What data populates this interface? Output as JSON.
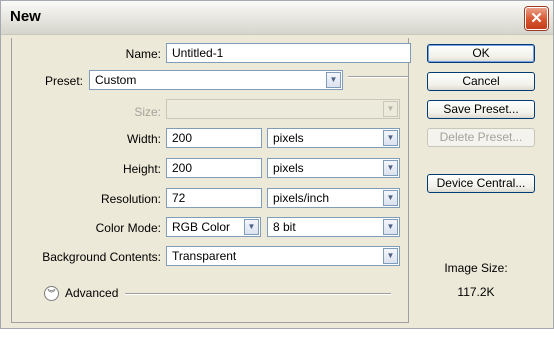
{
  "window": {
    "title": "New",
    "close_glyph": "✕"
  },
  "form": {
    "name_label": "Name:",
    "name_value": "Untitled-1",
    "preset_label": "Preset:",
    "preset_value": "Custom",
    "size_label": "Size:",
    "size_value": "",
    "width_label": "Width:",
    "width_value": "200",
    "width_unit": "pixels",
    "height_label": "Height:",
    "height_value": "200",
    "height_unit": "pixels",
    "resolution_label": "Resolution:",
    "resolution_value": "72",
    "resolution_unit": "pixels/inch",
    "color_mode_label": "Color Mode:",
    "color_mode_value": "RGB Color",
    "bit_depth_value": "8 bit",
    "background_label": "Background Contents:",
    "background_value": "Transparent",
    "advanced_label": "Advanced",
    "advanced_icon": "chevron-double-down-icon"
  },
  "buttons": {
    "ok": "OK",
    "cancel": "Cancel",
    "save_preset": "Save Preset...",
    "delete_preset": "Delete Preset...",
    "device_central": "Device Central..."
  },
  "info": {
    "image_size_label": "Image Size:",
    "image_size_value": "117.2K"
  },
  "colors": {
    "window_bg": "#ece9d8",
    "field_border": "#7f9db9",
    "button_border": "#003c74",
    "close_red": "#d8542f"
  }
}
